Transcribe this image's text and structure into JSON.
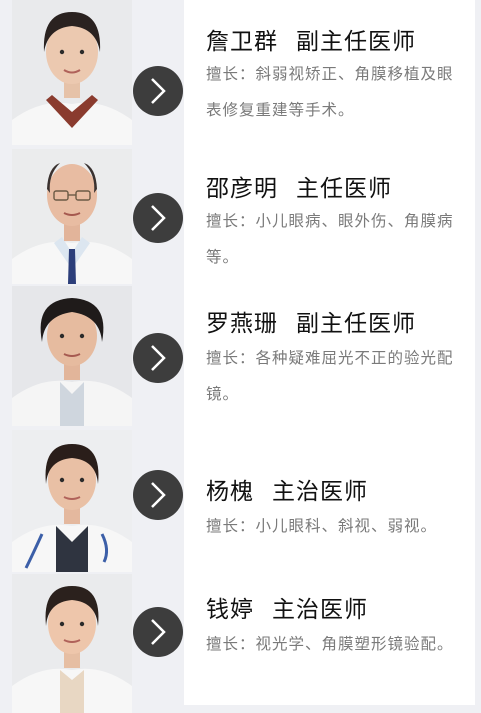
{
  "doctors": [
    {
      "name": "詹卫群",
      "title": "副主任医师",
      "desc": "擅长：斜弱视矫正、角膜移植及眼表修复重建等手术。"
    },
    {
      "name": "邵彦明",
      "title": "主任医师",
      "desc": "擅长：小儿眼病、眼外伤、角膜病等。"
    },
    {
      "name": "罗燕珊",
      "title": "副主任医师",
      "desc": "擅长：各种疑难屈光不正的验光配镜。"
    },
    {
      "name": "杨槐",
      "title": "主治医师",
      "desc": "擅长：小儿眼科、斜视、弱视。"
    },
    {
      "name": "钱婷",
      "title": "主治医师",
      "desc": "擅长：视光学、角膜塑形镜验配。"
    }
  ],
  "icons": {
    "arrow": "chevron-right-icon"
  }
}
